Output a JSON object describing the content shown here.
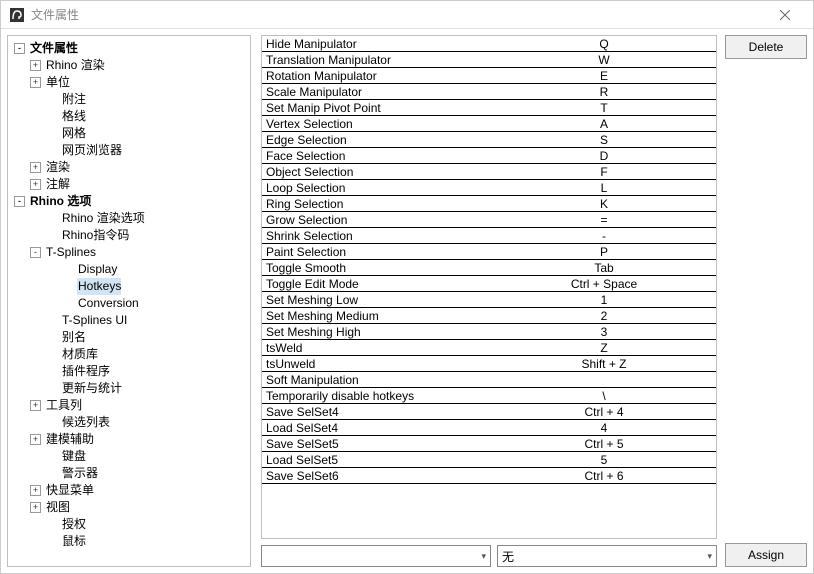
{
  "window": {
    "title": "文件属性"
  },
  "tree": [
    {
      "indent": 0,
      "toggle": "-",
      "label": "文件属性",
      "bold": true
    },
    {
      "indent": 1,
      "toggle": "+",
      "label": "Rhino 渲染"
    },
    {
      "indent": 1,
      "toggle": "+",
      "label": "单位"
    },
    {
      "indent": 2,
      "toggle": "",
      "label": "附注"
    },
    {
      "indent": 2,
      "toggle": "",
      "label": "格线"
    },
    {
      "indent": 2,
      "toggle": "",
      "label": "网格"
    },
    {
      "indent": 2,
      "toggle": "",
      "label": "网页浏览器"
    },
    {
      "indent": 1,
      "toggle": "+",
      "label": "渲染"
    },
    {
      "indent": 1,
      "toggle": "+",
      "label": "注解"
    },
    {
      "indent": 0,
      "toggle": "-",
      "label": "Rhino 选项",
      "bold": true
    },
    {
      "indent": 2,
      "toggle": "",
      "label": "Rhino 渲染选项"
    },
    {
      "indent": 2,
      "toggle": "",
      "label": "Rhino指令码"
    },
    {
      "indent": 1,
      "toggle": "-",
      "label": "T-Splines"
    },
    {
      "indent": 3,
      "toggle": "",
      "label": "Display"
    },
    {
      "indent": 3,
      "toggle": "",
      "label": "Hotkeys",
      "selected": true
    },
    {
      "indent": 3,
      "toggle": "",
      "label": "Conversion"
    },
    {
      "indent": 2,
      "toggle": "",
      "label": "T-Splines UI"
    },
    {
      "indent": 2,
      "toggle": "",
      "label": "别名"
    },
    {
      "indent": 2,
      "toggle": "",
      "label": "材质库"
    },
    {
      "indent": 2,
      "toggle": "",
      "label": "插件程序"
    },
    {
      "indent": 2,
      "toggle": "",
      "label": "更新与统计"
    },
    {
      "indent": 1,
      "toggle": "+",
      "label": "工具列"
    },
    {
      "indent": 2,
      "toggle": "",
      "label": "候选列表"
    },
    {
      "indent": 1,
      "toggle": "+",
      "label": "建模辅助"
    },
    {
      "indent": 2,
      "toggle": "",
      "label": "键盘"
    },
    {
      "indent": 2,
      "toggle": "",
      "label": "警示器"
    },
    {
      "indent": 1,
      "toggle": "+",
      "label": "快显菜单"
    },
    {
      "indent": 1,
      "toggle": "+",
      "label": "视图"
    },
    {
      "indent": 2,
      "toggle": "",
      "label": "授权"
    },
    {
      "indent": 2,
      "toggle": "",
      "label": "鼠标"
    }
  ],
  "hotkeys": [
    {
      "label": "Hide Manipulator",
      "value": "Q"
    },
    {
      "label": "Translation Manipulator",
      "value": "W"
    },
    {
      "label": "Rotation Manipulator",
      "value": "E"
    },
    {
      "label": "Scale Manipulator",
      "value": "R"
    },
    {
      "label": "Set Manip Pivot Point",
      "value": "T"
    },
    {
      "label": "Vertex Selection",
      "value": "A"
    },
    {
      "label": "Edge Selection",
      "value": "S"
    },
    {
      "label": "Face Selection",
      "value": "D"
    },
    {
      "label": "Object Selection",
      "value": "F"
    },
    {
      "label": "Loop Selection",
      "value": "L"
    },
    {
      "label": "Ring Selection",
      "value": "K"
    },
    {
      "label": "Grow Selection",
      "value": "="
    },
    {
      "label": "Shrink Selection",
      "value": "-"
    },
    {
      "label": "Paint Selection",
      "value": "P"
    },
    {
      "label": "Toggle Smooth",
      "value": "Tab"
    },
    {
      "label": "Toggle Edit Mode",
      "value": "Ctrl + Space"
    },
    {
      "label": "Set Meshing Low",
      "value": "1"
    },
    {
      "label": "Set Meshing Medium",
      "value": "2"
    },
    {
      "label": "Set Meshing High",
      "value": "3"
    },
    {
      "label": "tsWeld",
      "value": "Z"
    },
    {
      "label": "tsUnweld",
      "value": "Shift + Z"
    },
    {
      "label": "Soft Manipulation",
      "value": ""
    },
    {
      "label": "Temporarily disable hotkeys",
      "value": "\\"
    },
    {
      "label": "Save SelSet4",
      "value": "Ctrl + 4"
    },
    {
      "label": "Load SelSet4",
      "value": "4"
    },
    {
      "label": "Save SelSet5",
      "value": "Ctrl + 5"
    },
    {
      "label": "Load SelSet5",
      "value": "5"
    },
    {
      "label": "Save SelSet6",
      "value": "Ctrl + 6"
    }
  ],
  "bottom": {
    "combo1_value": "",
    "combo2_value": "无"
  },
  "buttons": {
    "delete": "Delete",
    "assign": "Assign"
  }
}
